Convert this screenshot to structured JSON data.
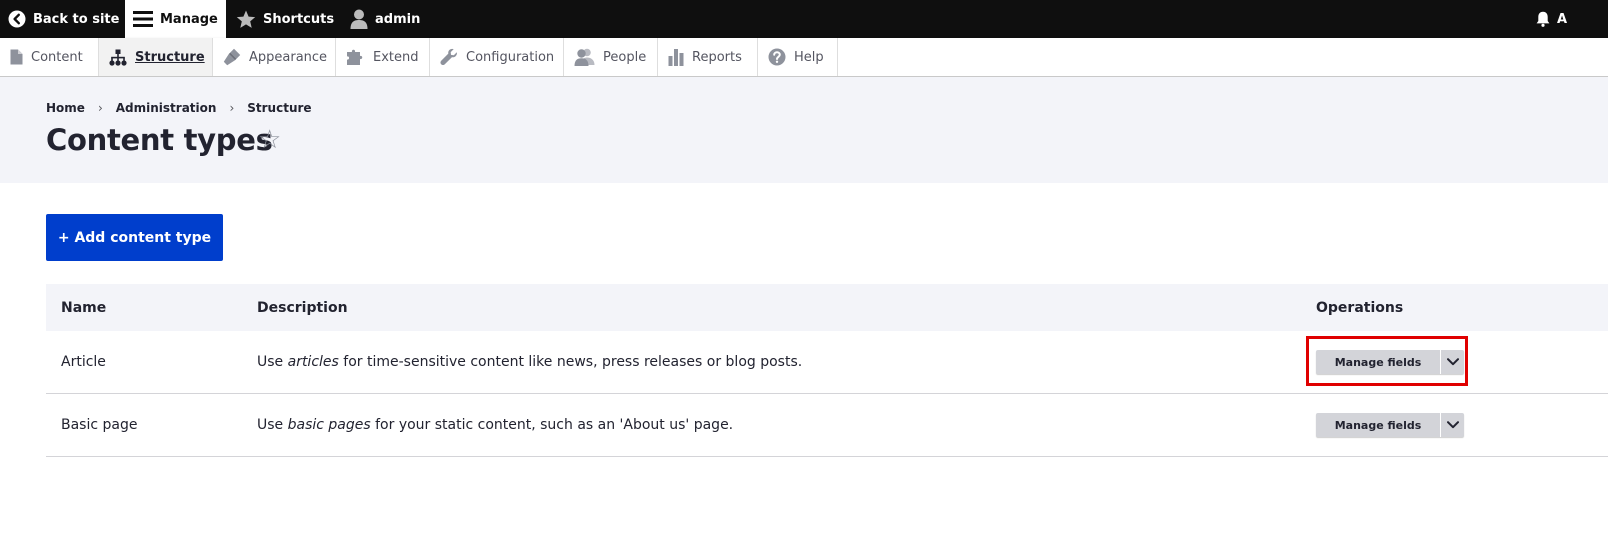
{
  "toolbar": {
    "back_to_site": "Back to site",
    "manage": "Manage",
    "shortcuts": "Shortcuts",
    "user": "admin",
    "right_letter": "A"
  },
  "tray": {
    "items": [
      {
        "label": "Content"
      },
      {
        "label": "Structure"
      },
      {
        "label": "Appearance"
      },
      {
        "label": "Extend"
      },
      {
        "label": "Configuration"
      },
      {
        "label": "People"
      },
      {
        "label": "Reports"
      },
      {
        "label": "Help"
      }
    ]
  },
  "breadcrumb": [
    "Home",
    "Administration",
    "Structure"
  ],
  "breadcrumb_separator": "›",
  "page": {
    "title": "Content types",
    "star": "☆"
  },
  "actions": {
    "add_label": "+ Add content type"
  },
  "table": {
    "headers": {
      "name": "Name",
      "description": "Description",
      "operations": "Operations"
    },
    "rows": [
      {
        "name": "Article",
        "desc_pre": "Use ",
        "desc_em": "articles",
        "desc_post": " for time-sensitive content like news, press releases or blog posts.",
        "op_label": "Manage fields"
      },
      {
        "name": "Basic page",
        "desc_pre": "Use ",
        "desc_em": "basic pages",
        "desc_post": " for your static content, such as an 'About us' page.",
        "op_label": "Manage fields"
      }
    ]
  },
  "colors": {
    "accent": "#003ecc",
    "highlight": "#e00000",
    "toolbar_bg": "#0f0f0f",
    "header_bg": "#f3f4f9"
  }
}
